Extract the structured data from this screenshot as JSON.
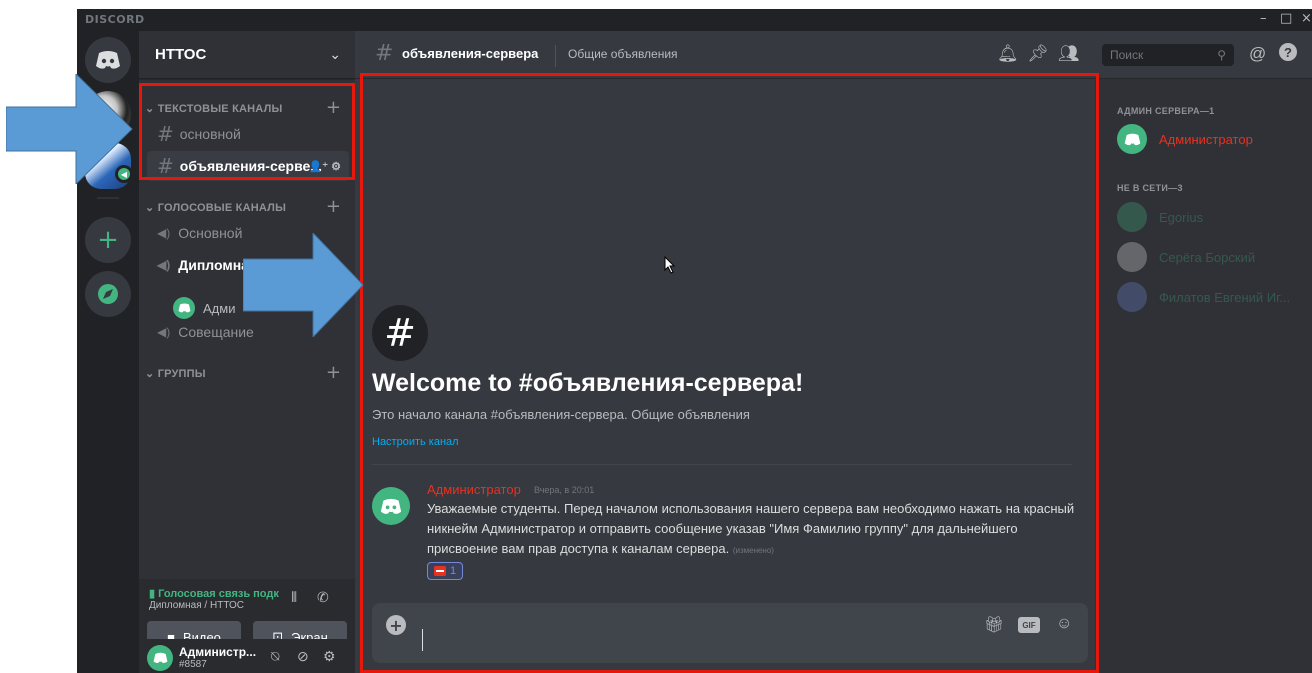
{
  "app": {
    "brand": "DISCORD",
    "window_controls": [
      "–",
      "□",
      "×"
    ]
  },
  "server": {
    "name": "НТТОС"
  },
  "categories": {
    "text": "ТЕКСТОВЫЕ КАНАЛЫ",
    "voice": "ГОЛОСОВЫЕ КАНАЛЫ",
    "groups": "ГРУППЫ"
  },
  "text_channels": [
    {
      "name": "основной"
    },
    {
      "name": "объявления-серве...",
      "active": true
    }
  ],
  "voice_channels": [
    {
      "name": "Основной"
    },
    {
      "name": "Дипломная"
    },
    {
      "name": "Совещание"
    }
  ],
  "voice_user": {
    "name": "Адми"
  },
  "voice_panel": {
    "status": "Голосовая связь подк",
    "location": "Дипломная / НТТОС",
    "video_label": "Видео",
    "screen_label": "Экран"
  },
  "user_panel": {
    "name": "Администр...",
    "tag": "#8587"
  },
  "topbar": {
    "channel": "объявления-сервера",
    "topic": "Общие объявления",
    "search_placeholder": "Поиск"
  },
  "welcome": {
    "title": "Welcome to #объявления-сервера!",
    "subtitle": "Это начало канала #объявления-сервера. Общие объявления",
    "edit_link": "Настроить канал"
  },
  "message": {
    "author": "Администратор",
    "time": "Вчера, в 20:01",
    "text": "Уважаемые студенты. Перед началом использования нашего сервера вам необходимо нажать на красный никнейм Администратор и отправить сообщение указав \"Имя Фамилию группу\" для дальнейшего присвоение вам прав доступа к каналам сервера.",
    "edited": "(изменено)",
    "reaction_count": "1"
  },
  "members": {
    "admin_category": "АДМИН СЕРВЕРА—1",
    "offline_category": "НЕ В СЕТИ—3",
    "admin": [
      {
        "name": "Администратор",
        "color": "#e9311f"
      }
    ],
    "offline": [
      {
        "name": "Egorius"
      },
      {
        "name": "Серёга Борский"
      },
      {
        "name": "Филатов Евгений Иг..."
      }
    ]
  },
  "colors": {
    "accent": "#7289da",
    "online": "#43b581",
    "admin": "#e9311f",
    "highlight": "#e8170b",
    "arrow": "#5b9bd5"
  }
}
